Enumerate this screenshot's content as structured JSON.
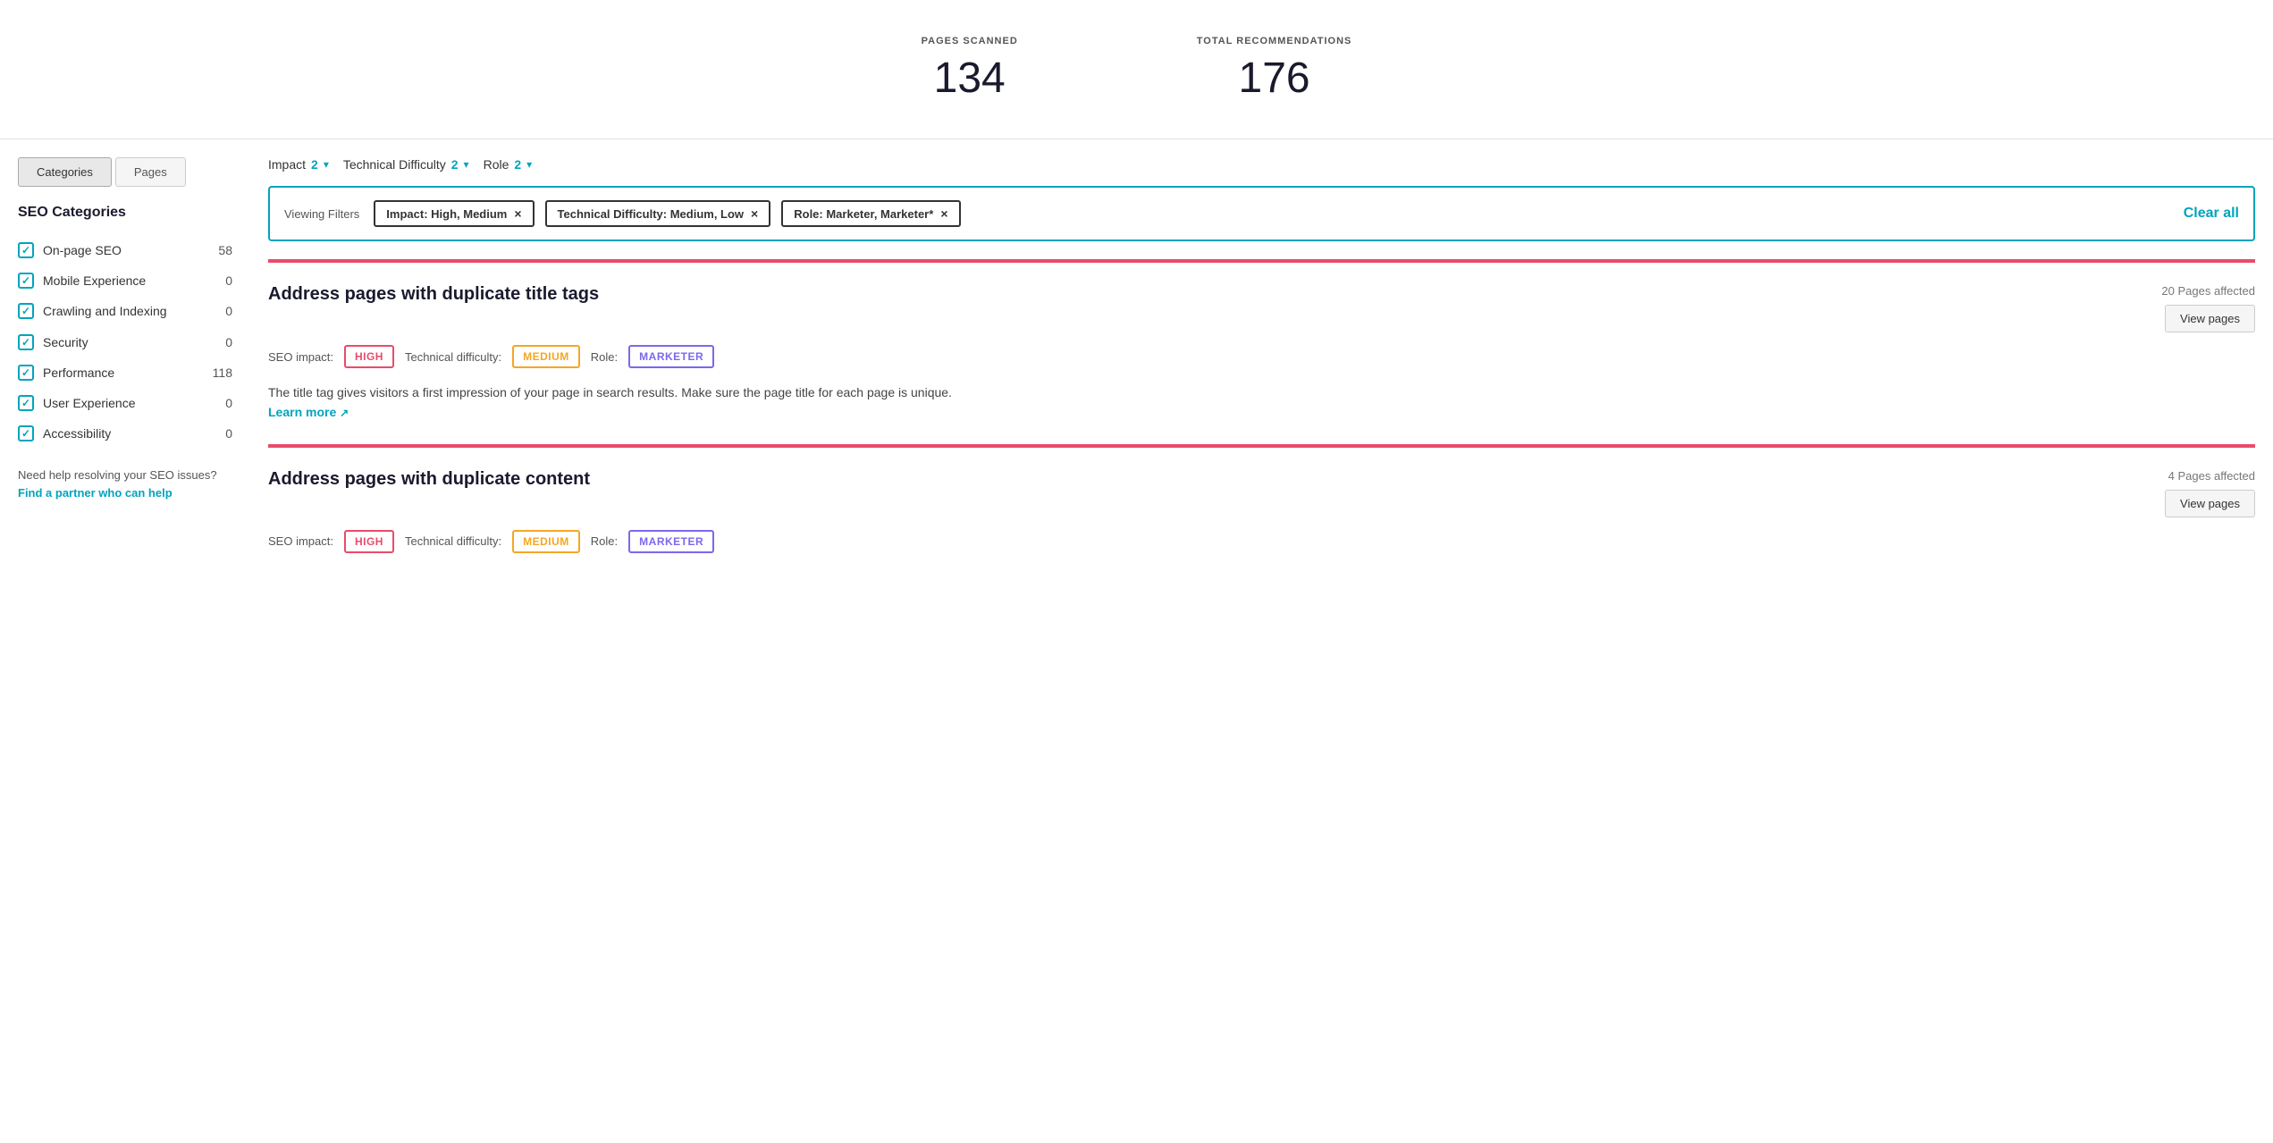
{
  "stats": {
    "pages_scanned_label": "PAGES SCANNED",
    "pages_scanned_value": "134",
    "total_recommendations_label": "TOTAL RECOMMENDATIONS",
    "total_recommendations_value": "176"
  },
  "tabs": [
    {
      "label": "Categories",
      "active": true
    },
    {
      "label": "Pages",
      "active": false
    }
  ],
  "sidebar": {
    "title": "SEO Categories",
    "categories": [
      {
        "name": "On-page SEO",
        "count": "58"
      },
      {
        "name": "Mobile Experience",
        "count": "0"
      },
      {
        "name": "Crawling and\nIndexing",
        "count": "0"
      },
      {
        "name": "Security",
        "count": "0"
      },
      {
        "name": "Performance",
        "count": "118"
      },
      {
        "name": "User Experience",
        "count": "0"
      },
      {
        "name": "Accessibility",
        "count": "0"
      }
    ],
    "help_text": "Need help resolving your SEO issues?",
    "help_link_text": "Find a partner who can help"
  },
  "filters": {
    "impact_label": "Impact",
    "impact_count": "2",
    "technical_difficulty_label": "Technical Difficulty",
    "technical_difficulty_count": "2",
    "role_label": "Role",
    "role_count": "2",
    "viewing_filters_label": "Viewing Filters",
    "filter_tags": [
      {
        "label": "Impact: High, Medium"
      },
      {
        "label": "Technical Difficulty: Medium, Low"
      },
      {
        "label": "Role: Marketer, Marketer*"
      }
    ],
    "clear_all_label": "Clear all"
  },
  "recommendations": [
    {
      "title": "Address pages with duplicate title tags",
      "pages_affected": "20 Pages affected",
      "seo_impact_label": "SEO impact:",
      "seo_impact_value": "HIGH",
      "technical_difficulty_label": "Technical difficulty:",
      "technical_difficulty_value": "MEDIUM",
      "role_label": "Role:",
      "role_value": "MARKETER",
      "description": "The title tag gives visitors a first impression of your page in search results. Make sure the page title for each page is unique.",
      "learn_more_label": "Learn more",
      "view_pages_label": "View pages"
    },
    {
      "title": "Address pages with duplicate content",
      "pages_affected": "4 Pages affected",
      "seo_impact_label": "SEO impact:",
      "seo_impact_value": "HIGH",
      "technical_difficulty_label": "Technical difficulty:",
      "technical_difficulty_value": "MEDIUM",
      "role_label": "Role:",
      "role_value": "MARKETER",
      "description": "",
      "learn_more_label": "",
      "view_pages_label": "View pages"
    }
  ]
}
